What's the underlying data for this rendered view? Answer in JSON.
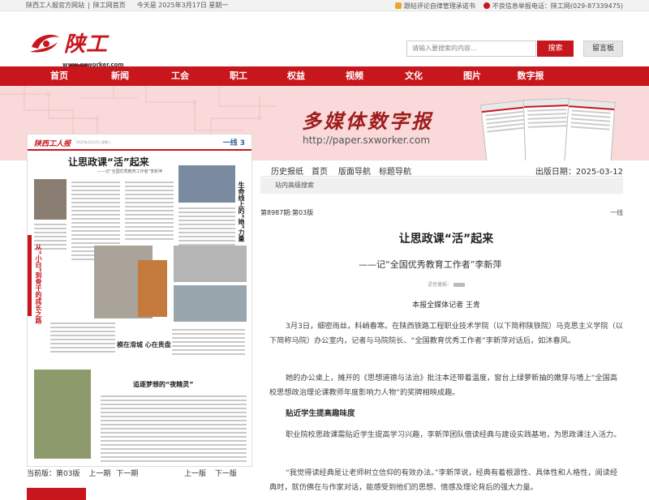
{
  "topbar": {
    "site": "陕西工人报官方网站",
    "sep": "|",
    "home": "陕工网首页",
    "date": "今天是 2025年3月17日 星期一",
    "pledge": "跟帖评论自律管理承诺书",
    "report": "不良信息举报电话：陕工网(029-87339475)"
  },
  "logo": {
    "text": "陕工网",
    "url": "www.sxworker.com"
  },
  "search": {
    "placeholder": "请输入要搜索的内容...",
    "button": "搜索",
    "message": "留言板"
  },
  "nav": [
    "首页",
    "新闻",
    "工会",
    "职工",
    "权益",
    "视频",
    "文化",
    "图片",
    "数字报"
  ],
  "banner": {
    "title": "多媒体数字报",
    "url": "http://paper.sxworker.com"
  },
  "colors": {
    "brand_red": "#c8161d",
    "banner_pink": "#f9d9d9"
  },
  "thumbnail": {
    "logo": "陕西工人报",
    "meta": "2025年3月12日 星期三",
    "section": "一线 3",
    "title": "让思政课“活”起来",
    "subtitle": "——记“全国优秀教育工作者”李新萍",
    "side_title": "生命线上的“她”力量",
    "left_vertical": "从“小白”到骨干的成长之路",
    "mid_title": "模在滑城 心在贵盘",
    "bottom_title": "追逐梦想的“夜精灵”"
  },
  "pager": {
    "current": "当前版：第03版",
    "prev": "上一期",
    "next": "下一期",
    "prev_page": "上一版",
    "next_page": "下一版"
  },
  "toolbar": {
    "items": [
      "历史报纸",
      "首页",
      "版面导航",
      "标题导航"
    ],
    "date": "出版日期：2025-03-12",
    "search": "站内高级搜索"
  },
  "issue": "第8987期:第03版",
  "section_label": "一线",
  "article": {
    "title": "让思政课“活”起来",
    "subtitle": "——记“全国优秀教育工作者”李新萍",
    "audio": "语音播报：",
    "author": "本报全媒体记者  王青",
    "p1": "3月3日，细密雨丝，料峭春寒。在陕西铁路工程职业技术学院（以下简称陕铁院）马克思主义学院（以下简称马院）办公室内，记者与马院院长、“全国教育优秀工作者”李新萍对话后，如沐春风。",
    "p2": "她的办公桌上，摊开的《思想道德与法治》批注本还带着温度，窗台上绿萝新抽的嫩芽与墙上“全国高校思想政治理论课教师年度影响力人物”的奖牌相映成趣。",
    "h2": "贴近学生提高趣味度",
    "p3": "职业院校思政课需贴近学生提高学习兴趣，李新萍团队借读经典与建设实践基地，为思政课注入活力。",
    "p4": "“我觉得读经典是让老师树立信仰的有效办法。”李新萍说，经典有着根源性、具体性和人格性，阅读经典时，就仿佛在与作家对话，能感受到他们的思想、情感及理论背后的强大力量。"
  }
}
